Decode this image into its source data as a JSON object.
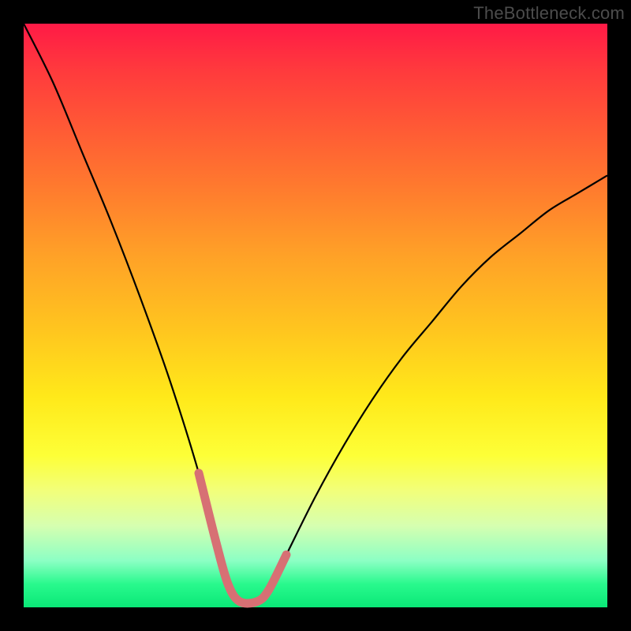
{
  "watermark": "TheBottleneck.com",
  "colors": {
    "frame": "#000000",
    "curve": "#000000",
    "accent_segment": "#d77074",
    "gradient_top": "#ff1a46",
    "gradient_bottom": "#0ae877"
  },
  "chart_data": {
    "type": "line",
    "title": "",
    "xlabel": "",
    "ylabel": "",
    "xlim": [
      0,
      100
    ],
    "ylim": [
      0,
      100
    ],
    "x": [
      0,
      5,
      10,
      15,
      20,
      25,
      30,
      33,
      35,
      37,
      40,
      42,
      45,
      50,
      55,
      60,
      65,
      70,
      75,
      80,
      85,
      90,
      95,
      100
    ],
    "series": [
      {
        "name": "bottleneck-curve",
        "values": [
          100,
          90,
          78,
          66,
          53,
          39,
          23,
          11,
          4,
          1,
          1,
          3,
          9,
          19,
          28,
          36,
          43,
          49,
          55,
          60,
          64,
          68,
          71,
          74
        ]
      }
    ],
    "accent_range_x": [
      31,
      44
    ],
    "legend": false,
    "grid": false
  }
}
